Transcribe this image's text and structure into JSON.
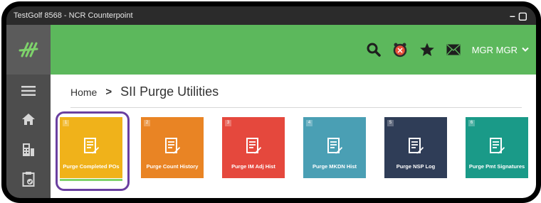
{
  "window": {
    "title": "TestGolf 8568 - NCR Counterpoint"
  },
  "header": {
    "user_label": "MGR MGR"
  },
  "breadcrumb": {
    "home": "Home",
    "separator": ">",
    "current": "SII Purge Utilities"
  },
  "tiles": [
    {
      "label": "Purge Completed POs",
      "color": "#f0b21a",
      "badge": "1"
    },
    {
      "label": "Purge Count History",
      "color": "#e98424",
      "badge": "2"
    },
    {
      "label": "Purge IM Adj Hist",
      "color": "#e5483d",
      "badge": "3"
    },
    {
      "label": "Purge MKDN Hist",
      "color": "#4a9fb4",
      "badge": "4"
    },
    {
      "label": "Purge NSP Log",
      "color": "#2f3d57",
      "badge": "5"
    },
    {
      "label": "Purge Pmt Signatures",
      "color": "#1a9a88",
      "badge": "6"
    }
  ],
  "colors": {
    "topbar": "#5cb85c",
    "sidebar": "#4d4d4d",
    "highlight": "#6a3fa0"
  },
  "icons": [
    "app-logo-icon",
    "hamburger-menu-icon",
    "home-icon",
    "register-icon",
    "clipboard-check-icon",
    "search-icon",
    "alarm-clock-icon",
    "star-icon",
    "mail-icon",
    "chevron-down-icon",
    "document-edit-icon"
  ]
}
